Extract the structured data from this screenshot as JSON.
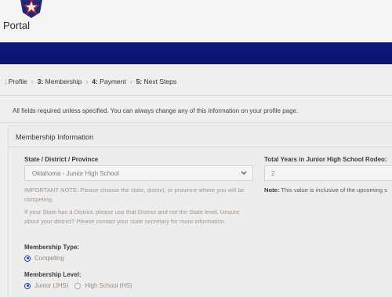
{
  "header": {
    "title": "Portal"
  },
  "steps": {
    "s1_label": "Profile",
    "s3_num": "3:",
    "s3_label": "Membership",
    "s4_num": "4:",
    "s4_label": "Payment",
    "s5_num": "5:",
    "s5_label": "Next Steps",
    "separator": "›"
  },
  "required_note": "All fields required unless specified. You can always change any of this information on your profile page.",
  "section": {
    "title": "Membership Information"
  },
  "state_field": {
    "label": "State / District / Province",
    "value": "Oklahoma - Junior High School"
  },
  "years_field": {
    "label": "Total Years in Junior High School Rodeo:",
    "value": "2",
    "note_label": "Note:",
    "note_text": "This value is inclusive of the upcoming s"
  },
  "help": {
    "important": "IMPORTANT NOTE: Please choose the state, district, or province where you will be competing.",
    "district": "If your State has a District, please use that District and not the State level. Unsure about your district? Please contact your state secretary for more information."
  },
  "membership_type": {
    "label": "Membership Type:",
    "option": "Competing"
  },
  "membership_level": {
    "label": "Membership Level:",
    "option_junior": "Junior (JHS)",
    "option_high": "High School (HS)"
  },
  "colors": {
    "banner": "#0e1a7c",
    "radio_accent": "#1d3fa8"
  }
}
